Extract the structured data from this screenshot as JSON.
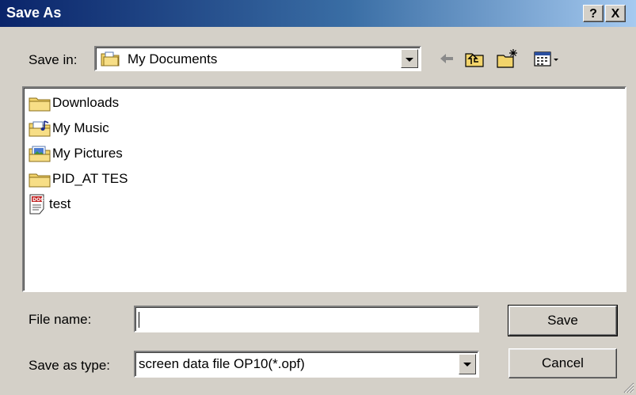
{
  "window": {
    "title": "Save As",
    "help_label": "?",
    "close_label": "X"
  },
  "toolbar": {
    "save_in_label": "Save in:",
    "save_in_value": "My Documents",
    "icons": [
      "back-arrow-icon",
      "up-folder-icon",
      "new-folder-icon",
      "view-menu-icon"
    ]
  },
  "files": [
    {
      "name": "Downloads",
      "icon": "folder-icon"
    },
    {
      "name": "My Music",
      "icon": "music-folder-icon"
    },
    {
      "name": "My Pictures",
      "icon": "pictures-folder-icon"
    },
    {
      "name": "PID_AT TES",
      "icon": "folder-icon"
    },
    {
      "name": "test",
      "icon": "doc-file-icon"
    }
  ],
  "form": {
    "filename_label": "File name:",
    "filename_value": "",
    "type_label": "Save as type:",
    "type_value": "screen data file OP10(*.opf)"
  },
  "buttons": {
    "save": "Save",
    "cancel": "Cancel"
  },
  "colors": {
    "title_start": "#0a246a",
    "title_end": "#a6caf0",
    "dialog_bg": "#d4d0c8",
    "folder_yellow": "#f2d46b"
  }
}
